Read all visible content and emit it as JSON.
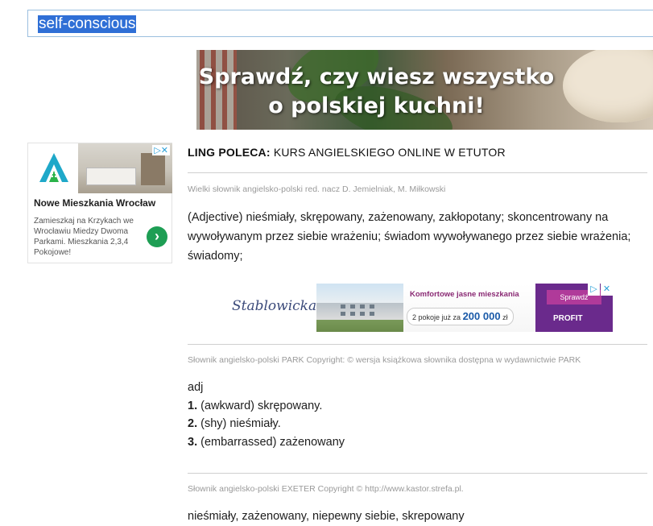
{
  "search": {
    "query": "self-conscious"
  },
  "banner": {
    "line1": "Sprawdź, czy wiesz wszystko",
    "line2": "o polskiej kuchni!"
  },
  "ad_left": {
    "title": "Nowe Mieszkania Wrocław",
    "description": "Zamieszkaj na Krzykach we Wrocławiu Miedzy Dwoma Parkami. Mieszkania 2,3,4 Pokojowe!",
    "go_icon": "chevron-right-icon",
    "adchoices": "▷✕"
  },
  "promo": {
    "bold": "LING POLECA:",
    "rest": " KURS ANGIELSKIEGO ONLINE W ETUTOR"
  },
  "entries": [
    {
      "source": "Wielki słownik angielsko-polski red. nacz D. Jemielniak, M. Miłkowski",
      "definition": "(Adjective) nieśmiały, skrępowany, zażenowany, zakłopotany; skoncentrowany na wywoływanym przez siebie wrażeniu; świadom wywoływanego przez siebie wrażenia; świadomy;"
    },
    {
      "source": "Słownik angielsko-polski PARK Copyright: © wersja książkowa słownika dostępna w wydawnictwie PARK",
      "pos": "adj",
      "senses": [
        {
          "num": "1.",
          "text": " (awkward) skrępowany."
        },
        {
          "num": "2.",
          "text": " (shy) nieśmiały."
        },
        {
          "num": "3.",
          "text": " (embarrassed) zażenowany"
        }
      ]
    },
    {
      "source": "Słownik angielsko-polski EXETER Copyright © http://www.kastor.strefa.pl.",
      "definition": "nieśmiały, zażenowany, niepewny siebie, skrepowany"
    }
  ],
  "ad_mid": {
    "brand": "Stablowicka",
    "headline": "Komfortowe jasne mieszkania",
    "rooms_prefix": "2 pokoje już za",
    "price": "200 000",
    "currency": "zł",
    "cta": "Sprawdź",
    "developer": "PROFIT",
    "adchoices_play": "▷",
    "adchoices_close": "✕"
  },
  "colors": {
    "search_highlight": "#2f6fd6",
    "ad_green": "#1e9e54",
    "ad_purple": "#6a2a8c"
  }
}
